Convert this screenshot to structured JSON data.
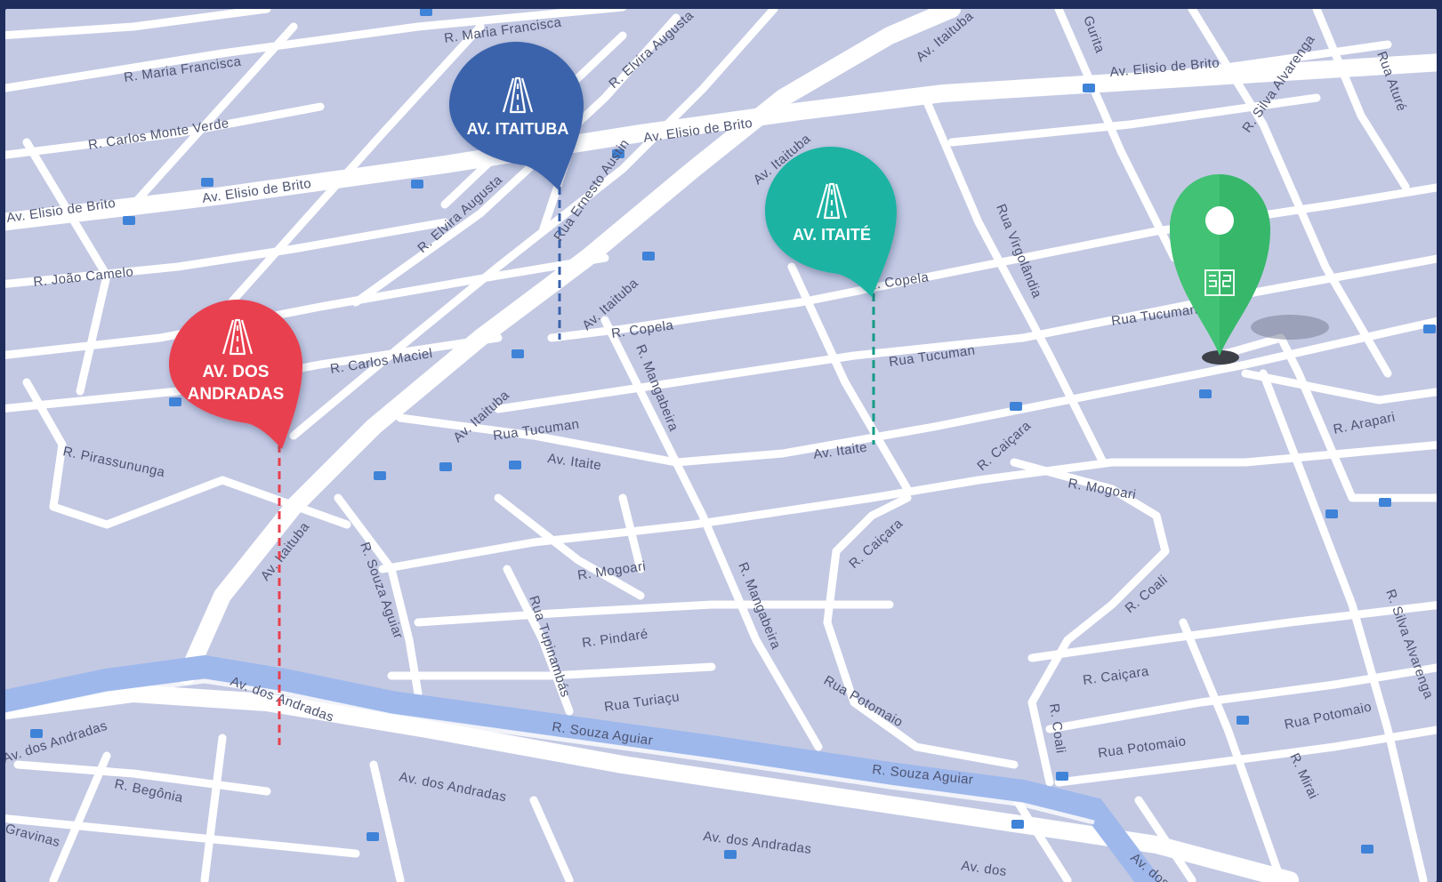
{
  "map": {
    "colors": {
      "background": "#c3c9e3",
      "road": "#ffffff",
      "river": "#9eb8ec",
      "frame": "#1e2d5c",
      "label": "#4d5472",
      "bus_stop": "#3f83d8"
    },
    "street_labels": [
      "R. Maria Francisca",
      "R. Maria Francisca",
      "R. Carlos Monte Verde",
      "Av. Elisio de Brito",
      "Av. Elisio de Brito",
      "Av. Elisio de Brito",
      "Av. Elisio de Brito",
      "R. João Camelo",
      "R. Carlos Maciel",
      "R. Elvira Augusta",
      "R. Elvira Augusta",
      "Rua Ernesto Austin",
      "Av. Itaituba",
      "Av. Itaituba",
      "Av. Itaituba",
      "Av. Itaituba",
      "Av. Itaituba",
      "R. Copela",
      "R. Copela",
      "R. Mangabeira",
      "R. Mangabeira",
      "Rua Tucuman",
      "Rua Tucuman",
      "Rua Tucuman",
      "Av. Itaite",
      "Av. Itaite",
      "R. Pirassununga",
      "R. Souza Aguiar",
      "R. Souza Aguiar",
      "R. Souza Aguiar",
      "R. Mogoari",
      "R. Mogoari",
      "R. Pindaré",
      "Rua Turiaçu",
      "Rua Tupinambás",
      "Rua Virgolândia",
      "R. Caiçara",
      "R. Caiçara",
      "R. Caiçara",
      "R. Coali",
      "R. Coali",
      "Rua Potomaio",
      "Rua Potomaio",
      "Rua Potomaio",
      "R. Arapari",
      "R. Silva Alvarenga",
      "R. Silva Alvarenga",
      "Rua Aturé",
      "R. Mirai",
      "Av. dos Andradas",
      "Av. dos Andradas",
      "Av. dos Andradas",
      "Av. dos Andradas",
      "Av. dos",
      "R. Begônia",
      "Gravinas",
      "Gurita",
      "Av. dos"
    ],
    "pins": [
      {
        "name": "AV. DOS ANDRADAS",
        "line1": "AV. DOS",
        "line2": "ANDRADAS",
        "color": "#e8414f",
        "icon": "road-icon"
      },
      {
        "name": "AV. ITAITUBA",
        "line1": "AV. ITAITUBA",
        "line2": "",
        "color": "#3b63ab",
        "icon": "road-icon"
      },
      {
        "name": "AV. ITAITÉ",
        "line1": "AV. ITAITÉ",
        "line2": "",
        "color": "#1fb3a3",
        "icon": "road-icon"
      }
    ],
    "location_pin": {
      "color": "#37b76a",
      "icon": "building-logo-icon"
    }
  }
}
